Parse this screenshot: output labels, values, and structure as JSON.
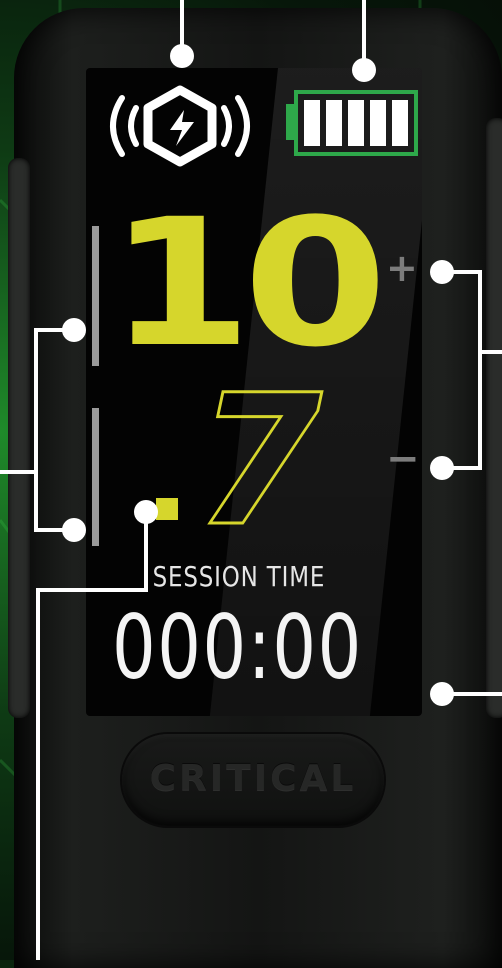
{
  "display": {
    "power_whole": "10",
    "power_decimal": "7",
    "plus_symbol": "+",
    "minus_symbol": "−",
    "session_label": "SESSION TIME",
    "session_time": "000:00"
  },
  "battery": {
    "level": 1.0,
    "color": "#2ea84a"
  },
  "fire_button": {
    "label": "CRITICAL"
  },
  "colors": {
    "accent_yellow": "#d6d62c",
    "background_green": "#1f8a2a",
    "screen_black": "#030303"
  },
  "icons": [
    "wireless-charging-icon",
    "battery-icon",
    "plus-icon",
    "minus-icon"
  ]
}
